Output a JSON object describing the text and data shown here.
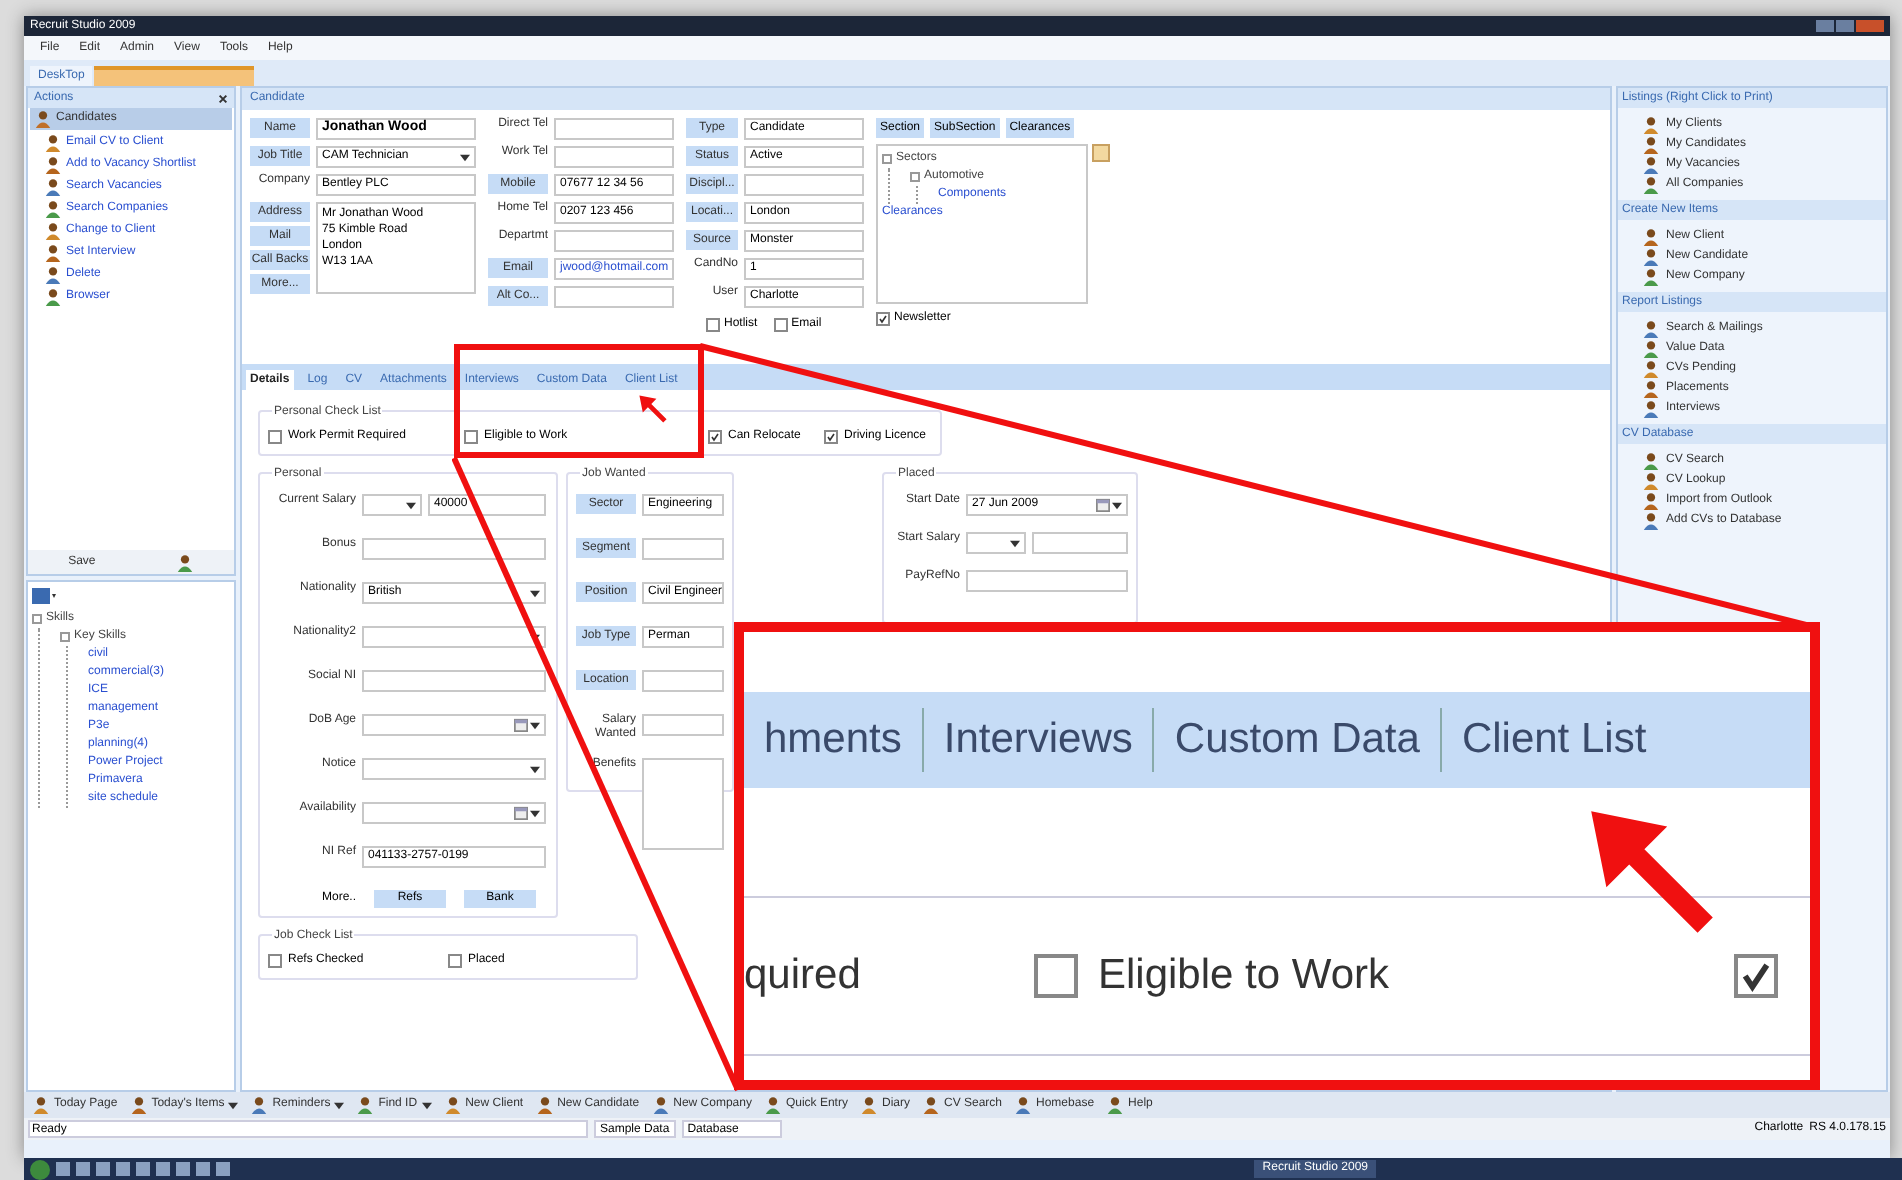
{
  "window": {
    "title": "Recruit Studio 2009"
  },
  "menu": [
    "File",
    "Edit",
    "Admin",
    "View",
    "Tools",
    "Help"
  ],
  "doc_tabs": [
    {
      "label": "DeskTop",
      "selected": false
    }
  ],
  "actions": {
    "title": "Actions",
    "group": "Candidates",
    "items": [
      "Email CV to Client",
      "Add to Vacancy Shortlist",
      "Search Vacancies",
      "Search Companies",
      "Change to Client",
      "Set Interview",
      "Delete",
      "Browser"
    ],
    "save": "Save"
  },
  "skills": [
    {
      "label": "Skills",
      "children": [
        {
          "label": "Key Skills",
          "children": [
            {
              "label": "civil"
            },
            {
              "label": "commercial(3)"
            },
            {
              "label": "ICE"
            },
            {
              "label": "management"
            },
            {
              "label": "P3e"
            },
            {
              "label": "planning(4)"
            },
            {
              "label": "Power Project"
            },
            {
              "label": "Primavera"
            },
            {
              "label": "site schedule"
            }
          ]
        }
      ]
    }
  ],
  "candidate": {
    "title": "Candidate",
    "columns": [
      [
        {
          "button": "Name",
          "kind": "name",
          "value": "Jonathan Wood"
        },
        {
          "button": "Job Title",
          "kind": "dropdown",
          "value": "CAM Technician"
        },
        {
          "label": "Company",
          "kind": "text",
          "value": "Bentley PLC"
        },
        {
          "button": "Address",
          "kind": "area",
          "value": "Mr Jonathan Wood\n75 Kimble Road\nLondon\nW13 1AA",
          "buttons": [
            "Mail",
            "Call Backs",
            "More..."
          ]
        }
      ],
      [
        {
          "label": "Direct Tel",
          "kind": "text"
        },
        {
          "label": "Work Tel",
          "kind": "text"
        },
        {
          "button": "Mobile",
          "kind": "text",
          "value": "07677 12 34 56"
        },
        {
          "label": "Home Tel",
          "kind": "text",
          "value": "0207 123 456"
        },
        {
          "label": "Departmt",
          "kind": "text"
        },
        {
          "button": "Email",
          "kind": "link",
          "value": "jwood@hotmail.com"
        },
        {
          "button": "Alt Co...",
          "kind": "text"
        }
      ],
      [
        {
          "button": "Type",
          "kind": "text",
          "value": "Candidate"
        },
        {
          "button": "Status",
          "kind": "text",
          "value": "Active"
        },
        {
          "button": "Discipl...",
          "kind": "text"
        },
        {
          "button": "Locati...",
          "kind": "text",
          "value": "London"
        },
        {
          "button": "Source",
          "kind": "text",
          "value": "Monster"
        },
        {
          "label": "CandNo",
          "kind": "text",
          "value": "1"
        },
        {
          "label": "User",
          "kind": "text",
          "value": "Charlotte"
        }
      ]
    ],
    "flags": [
      {
        "label": "Hotlist",
        "checked": false
      },
      {
        "label": "Email",
        "checked": false
      }
    ],
    "section_buttons": [
      "Section",
      "SubSection",
      "Clearances"
    ],
    "sectors": [
      {
        "label": "Sectors",
        "children": [
          {
            "label": "Automotive",
            "children": [
              {
                "label": "Components"
              }
            ]
          }
        ]
      },
      {
        "label": "Clearances"
      }
    ],
    "newsletter": {
      "label": "Newsletter",
      "checked": true
    }
  },
  "detail_tabs": [
    {
      "label": "Details",
      "selected": true
    },
    {
      "label": "Log",
      "selected": false
    },
    {
      "label": "CV",
      "selected": false
    },
    {
      "label": "Attachments",
      "selected": false
    },
    {
      "label": "Interviews",
      "selected": false
    },
    {
      "label": "Custom Data",
      "selected": false
    },
    {
      "label": "Client List",
      "selected": false
    }
  ],
  "personal_check_list": {
    "title": "Personal Check List",
    "items": [
      {
        "label": "Work Permit Required",
        "checked": false
      },
      {
        "label": "Eligible to Work",
        "checked": false
      },
      {
        "label": "Can Relocate",
        "checked": true
      },
      {
        "label": "Driving Licence",
        "checked": true
      }
    ]
  },
  "personal": {
    "title": "Personal",
    "fields": [
      {
        "label": "Current Salary",
        "kind": "salary",
        "value": "40000"
      },
      {
        "label": "Bonus",
        "kind": "text"
      },
      {
        "label": "Nationality",
        "kind": "dropdown",
        "value": "British"
      },
      {
        "label": "Nationality2",
        "kind": "dropdown"
      },
      {
        "label": "Social NI",
        "kind": "text"
      },
      {
        "label": "DoB Age",
        "kind": "date"
      },
      {
        "label": "Notice",
        "kind": "dropdown"
      },
      {
        "label": "Availability",
        "kind": "date"
      },
      {
        "label": "NI Ref",
        "kind": "text",
        "value": "041133-2757-0199"
      }
    ],
    "more": "More..",
    "buttons": [
      "Refs",
      "Bank"
    ]
  },
  "job_wanted": {
    "title": "Job Wanted",
    "fields": [
      {
        "button": "Sector",
        "kind": "text",
        "value": "Engineering"
      },
      {
        "button": "Segment",
        "kind": "text"
      },
      {
        "button": "Position",
        "kind": "text",
        "value": "Civil Engineer"
      },
      {
        "button": "Job Type",
        "kind": "text",
        "value": "Perman"
      },
      {
        "button": "Location",
        "kind": "text"
      },
      {
        "label": "Salary Wanted",
        "kind": "text"
      },
      {
        "label": "Benefits",
        "kind": "area"
      }
    ]
  },
  "placed": {
    "title": "Placed",
    "fields": [
      {
        "label": "Start Date",
        "kind": "date",
        "value": "27 Jun 2009"
      },
      {
        "label": "Start Salary",
        "kind": "salary"
      },
      {
        "label": "PayRefNo",
        "kind": "text"
      }
    ]
  },
  "job_check_list": {
    "title": "Job Check List",
    "items": [
      {
        "label": "Refs Checked",
        "checked": false
      },
      {
        "label": "Placed",
        "checked": false
      }
    ]
  },
  "right_panel": [
    {
      "title": "Listings (Right Click to Print)",
      "items": [
        "My Clients",
        "My Candidates",
        "My Vacancies",
        "All Companies"
      ]
    },
    {
      "title": "Create New Items",
      "items": [
        "New Client",
        "New Candidate",
        "New Company"
      ]
    },
    {
      "title": "Report Listings",
      "items": [
        "Search & Mailings",
        "Value Data",
        "CVs Pending",
        "Placements",
        "Interviews"
      ]
    },
    {
      "title": "CV Database",
      "items": [
        "CV Search",
        "CV Lookup",
        "Import from Outlook",
        "Add CVs to Database"
      ]
    }
  ],
  "toolbar": [
    {
      "label": "Today Page",
      "menu": false
    },
    {
      "label": "Today's Items",
      "menu": true
    },
    {
      "label": "Reminders",
      "menu": true
    },
    {
      "label": "Find ID",
      "menu": true
    },
    {
      "label": "New Client",
      "menu": false
    },
    {
      "label": "New Candidate",
      "menu": false
    },
    {
      "label": "New Company",
      "menu": false
    },
    {
      "label": "Quick Entry",
      "menu": false
    },
    {
      "label": "Diary",
      "menu": false
    },
    {
      "label": "CV Search",
      "menu": false
    },
    {
      "label": "Homebase",
      "menu": false
    },
    {
      "label": "Help",
      "menu": false
    }
  ],
  "status_bar": {
    "state": "Ready",
    "data": "Sample Data",
    "database": "Database",
    "user": "Charlotte",
    "version": "RS 4.0.178.15"
  },
  "taskbar": {
    "apps": [
      "Recruit Studio 2009"
    ]
  },
  "callout": {
    "tabs": [
      "hments",
      "Interviews",
      "Custom Data",
      "Client List"
    ],
    "items": [
      {
        "label": "quired",
        "kind": "text"
      },
      {
        "label": "Eligible to Work",
        "kind": "checkbox",
        "checked": false
      },
      {
        "kind": "checkbox",
        "checked": true
      }
    ]
  }
}
